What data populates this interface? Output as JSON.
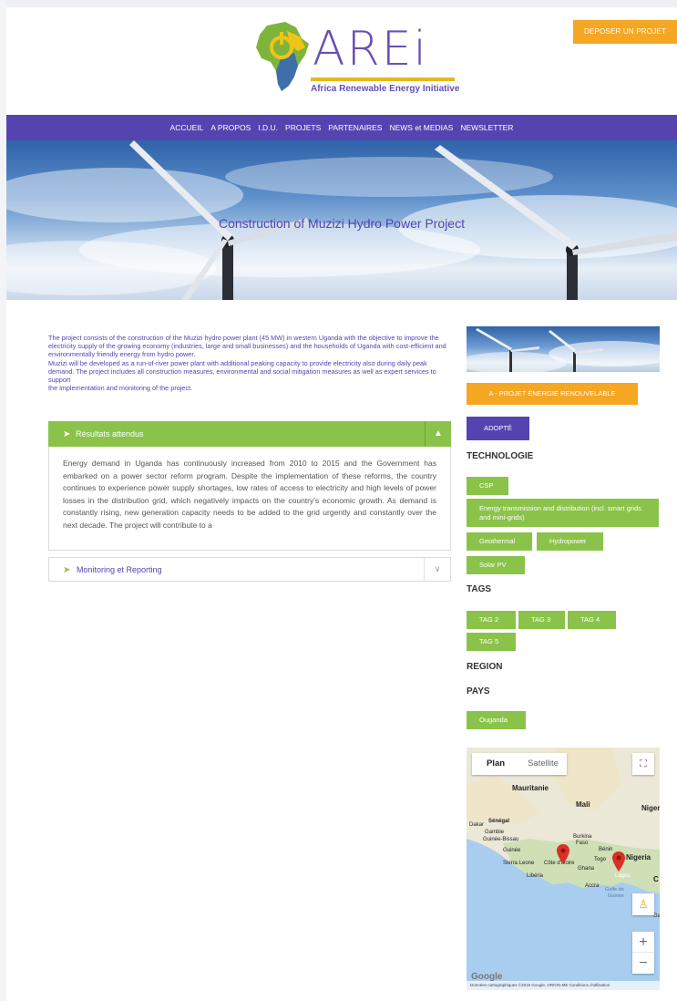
{
  "header": {
    "logo_text": "AREi",
    "logo_subtitle": "Africa Renewable Energy Initiative",
    "deposer_label": "DEPOSER UN PROJET"
  },
  "nav": {
    "items": [
      "ACCUEIL",
      "A PROPOS",
      "I.D.U.",
      "PROJETS",
      "PARTENAIRES",
      "NEWS et MEDIAS",
      "NEWSLETTER"
    ]
  },
  "hero": {
    "title": "Construction of Muzizi Hydro Power Project"
  },
  "intro": {
    "p1": "The project consists of the construction of the Muzizi hydro power plant (45 MW) in western Uganda with the objective to improve the electricity supply of the growing economy (industries, large and small businesses) and the households of Uganda with cost-efficient and environmentally friendly energy from hydro power.",
    "p2": "Muzizi will be developed as a run-of-river power plant with additional peaking capacity to provide electricity also during daily peak demand. The project includes all construction measures, environmental and social mitigation measures as well as expert services to support",
    "p3": "the implementation and monitoring of the project."
  },
  "accordion": {
    "item1_label": "Résultats attendus",
    "item1_body": "Energy demand in Uganda has continuously increased from 2010 to 2015 and the Government has embarked on a power sector reform program. Despite the implementation of these reforms, the country continues to experience power supply shortages, low rates of access to electricity and high levels of power losses in the distribution grid, which negatively impacts on the country's economic growth. As demand is constantly rising, new generation capacity needs to be added to the grid urgently and constantly over the next decade. The project will contribute to a",
    "item2_label": "Monitoring et Reporting"
  },
  "sidebar": {
    "category_label": "A - PROJET ÉNERGIE RENOUVELABLE",
    "status_label": "ADOPTÉ",
    "technologie_heading": "TECHNOLOGIE",
    "tech": {
      "csp": "CSP",
      "energy": "Energy transmission and distribution (incl. smart grids and mini-grids)",
      "geothermal": "Geothermal",
      "hydropower": "Hydropower",
      "solar": "Solar PV"
    },
    "tags_heading": "TAGS",
    "tags": {
      "t2": "TAG 2",
      "t3": "TAG 3",
      "t4": "TAG 4",
      "t5": "TAG 5"
    },
    "region_heading": "REGION",
    "pays_heading": "PAYS",
    "pays_value": "Ouganda"
  },
  "map": {
    "plan_label": "Plan",
    "satellite_label": "Satellite",
    "labels": {
      "mauritanie": "Mauritanie",
      "mali": "Mali",
      "niger": "Niger",
      "dakar": "Dakar",
      "senegal": "Sénégal",
      "gambie": "Gambie",
      "guinee_bissau": "Guinée-Bissau",
      "guinee": "Guinée",
      "burkina": "Burkina",
      "faso": "Faso",
      "benin": "Bénin",
      "nigeria": "Nigeria",
      "sierra_leone": "Sierra Leone",
      "cote_divoire": "Côte d'Ivoire",
      "togo": "Togo",
      "ghana": "Ghana",
      "lagos": "Lagos",
      "liberia": "Libéria",
      "accra": "Accra",
      "golfe": "Golfe de",
      "guinee_golfe": "Guinée",
      "c": "C",
      "ga": "Ga"
    },
    "google_label": "Google",
    "footer": "Données cartographiques ©2016 Google, ORION-ME   Conditions d'utilisation",
    "zoom_in": "+",
    "zoom_out": "−"
  }
}
